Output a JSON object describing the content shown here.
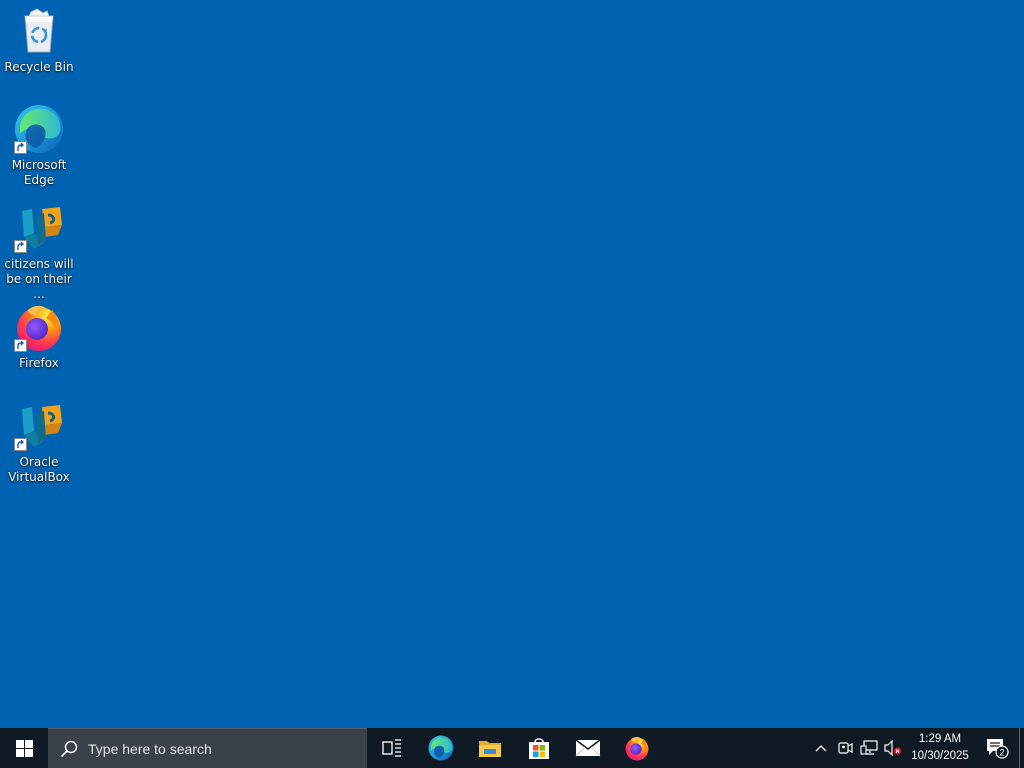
{
  "desktop": {
    "background_color": "#0063b1",
    "icons": [
      {
        "label": "Recycle Bin",
        "icon": "recycle-bin-icon"
      },
      {
        "label": "Microsoft Edge",
        "icon": "edge-icon"
      },
      {
        "label": "citizens will be on their ...",
        "icon": "virtualbox-icon"
      },
      {
        "label": "Firefox",
        "icon": "firefox-icon"
      },
      {
        "label": "Oracle VirtualBox",
        "icon": "virtualbox-icon"
      }
    ]
  },
  "taskbar": {
    "search_placeholder": "Type here to search",
    "apps": [
      {
        "name": "Task View",
        "icon": "task-view-icon"
      },
      {
        "name": "Microsoft Edge",
        "icon": "edge-icon"
      },
      {
        "name": "File Explorer",
        "icon": "folder-icon"
      },
      {
        "name": "Microsoft Store",
        "icon": "store-icon"
      },
      {
        "name": "Mail",
        "icon": "mail-icon"
      },
      {
        "name": "Firefox",
        "icon": "firefox-icon"
      }
    ],
    "tray": {
      "time": "1:29 AM",
      "date": "10/30/2025",
      "notification_count": "2"
    }
  }
}
